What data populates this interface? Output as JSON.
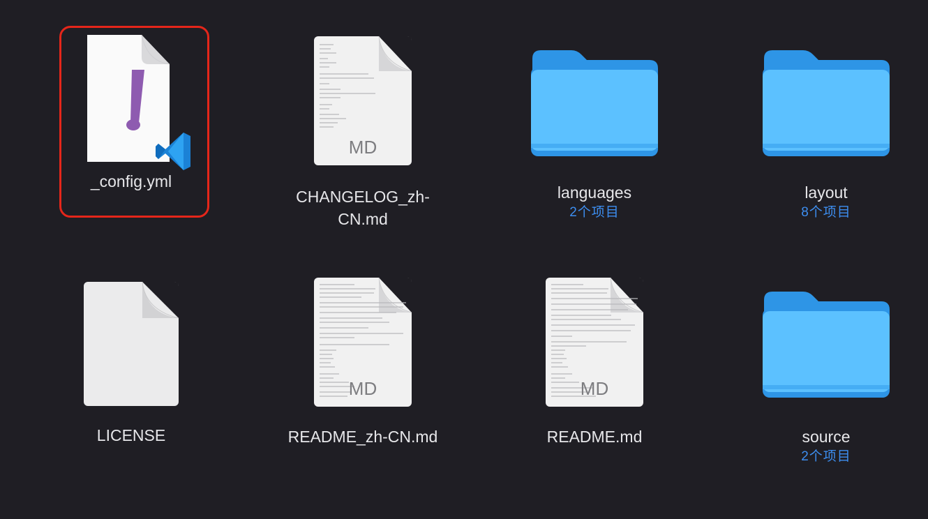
{
  "items": [
    {
      "id": "config",
      "name": "_config.yml",
      "sub": "",
      "selected": true
    },
    {
      "id": "changelog",
      "name": "CHANGELOG_zh-CN.md",
      "sub": "",
      "badge": "MD"
    },
    {
      "id": "languages",
      "name": "languages",
      "sub": "2个项目"
    },
    {
      "id": "layout",
      "name": "layout",
      "sub": "8个项目"
    },
    {
      "id": "license",
      "name": "LICENSE",
      "sub": ""
    },
    {
      "id": "readme_zh",
      "name": "README_zh-CN.md",
      "sub": "",
      "badge": "MD"
    },
    {
      "id": "readme",
      "name": "README.md",
      "sub": "",
      "badge": "MD"
    },
    {
      "id": "source",
      "name": "source",
      "sub": "2个项目"
    }
  ],
  "colors": {
    "background": "#1f1e24",
    "selection": "#e5261a",
    "folder_light": "#62c4ff",
    "folder_dark": "#2e95e6",
    "sublabel": "#3d8ef0",
    "yaml_mark": "#8e5bb0",
    "vscode_blue": "#1b82d6"
  },
  "icons": {
    "config": "yaml-file-vscode-icon",
    "changelog": "markdown-file-icon",
    "languages": "folder-icon",
    "layout": "folder-icon",
    "license": "blank-file-icon",
    "readme_zh": "markdown-file-icon",
    "readme": "markdown-file-icon",
    "source": "folder-icon"
  }
}
